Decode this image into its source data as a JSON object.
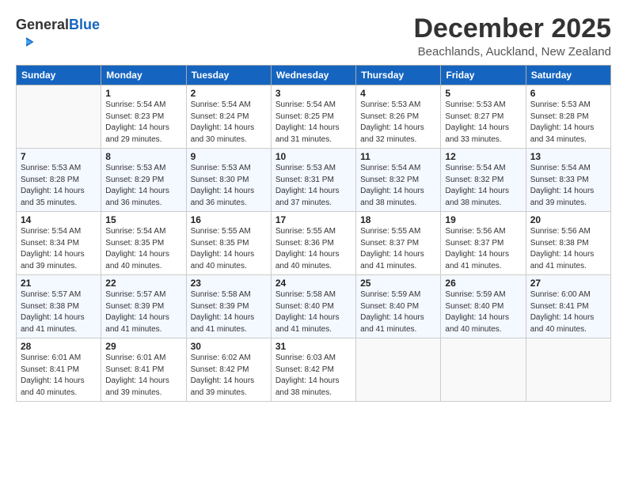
{
  "logo": {
    "general": "General",
    "blue": "Blue"
  },
  "title": "December 2025",
  "subtitle": "Beachlands, Auckland, New Zealand",
  "header_days": [
    "Sunday",
    "Monday",
    "Tuesday",
    "Wednesday",
    "Thursday",
    "Friday",
    "Saturday"
  ],
  "weeks": [
    [
      {
        "num": "",
        "info": ""
      },
      {
        "num": "1",
        "info": "Sunrise: 5:54 AM\nSunset: 8:23 PM\nDaylight: 14 hours\nand 29 minutes."
      },
      {
        "num": "2",
        "info": "Sunrise: 5:54 AM\nSunset: 8:24 PM\nDaylight: 14 hours\nand 30 minutes."
      },
      {
        "num": "3",
        "info": "Sunrise: 5:54 AM\nSunset: 8:25 PM\nDaylight: 14 hours\nand 31 minutes."
      },
      {
        "num": "4",
        "info": "Sunrise: 5:53 AM\nSunset: 8:26 PM\nDaylight: 14 hours\nand 32 minutes."
      },
      {
        "num": "5",
        "info": "Sunrise: 5:53 AM\nSunset: 8:27 PM\nDaylight: 14 hours\nand 33 minutes."
      },
      {
        "num": "6",
        "info": "Sunrise: 5:53 AM\nSunset: 8:28 PM\nDaylight: 14 hours\nand 34 minutes."
      }
    ],
    [
      {
        "num": "7",
        "info": "Sunrise: 5:53 AM\nSunset: 8:28 PM\nDaylight: 14 hours\nand 35 minutes."
      },
      {
        "num": "8",
        "info": "Sunrise: 5:53 AM\nSunset: 8:29 PM\nDaylight: 14 hours\nand 36 minutes."
      },
      {
        "num": "9",
        "info": "Sunrise: 5:53 AM\nSunset: 8:30 PM\nDaylight: 14 hours\nand 36 minutes."
      },
      {
        "num": "10",
        "info": "Sunrise: 5:53 AM\nSunset: 8:31 PM\nDaylight: 14 hours\nand 37 minutes."
      },
      {
        "num": "11",
        "info": "Sunrise: 5:54 AM\nSunset: 8:32 PM\nDaylight: 14 hours\nand 38 minutes."
      },
      {
        "num": "12",
        "info": "Sunrise: 5:54 AM\nSunset: 8:32 PM\nDaylight: 14 hours\nand 38 minutes."
      },
      {
        "num": "13",
        "info": "Sunrise: 5:54 AM\nSunset: 8:33 PM\nDaylight: 14 hours\nand 39 minutes."
      }
    ],
    [
      {
        "num": "14",
        "info": "Sunrise: 5:54 AM\nSunset: 8:34 PM\nDaylight: 14 hours\nand 39 minutes."
      },
      {
        "num": "15",
        "info": "Sunrise: 5:54 AM\nSunset: 8:35 PM\nDaylight: 14 hours\nand 40 minutes."
      },
      {
        "num": "16",
        "info": "Sunrise: 5:55 AM\nSunset: 8:35 PM\nDaylight: 14 hours\nand 40 minutes."
      },
      {
        "num": "17",
        "info": "Sunrise: 5:55 AM\nSunset: 8:36 PM\nDaylight: 14 hours\nand 40 minutes."
      },
      {
        "num": "18",
        "info": "Sunrise: 5:55 AM\nSunset: 8:37 PM\nDaylight: 14 hours\nand 41 minutes."
      },
      {
        "num": "19",
        "info": "Sunrise: 5:56 AM\nSunset: 8:37 PM\nDaylight: 14 hours\nand 41 minutes."
      },
      {
        "num": "20",
        "info": "Sunrise: 5:56 AM\nSunset: 8:38 PM\nDaylight: 14 hours\nand 41 minutes."
      }
    ],
    [
      {
        "num": "21",
        "info": "Sunrise: 5:57 AM\nSunset: 8:38 PM\nDaylight: 14 hours\nand 41 minutes."
      },
      {
        "num": "22",
        "info": "Sunrise: 5:57 AM\nSunset: 8:39 PM\nDaylight: 14 hours\nand 41 minutes."
      },
      {
        "num": "23",
        "info": "Sunrise: 5:58 AM\nSunset: 8:39 PM\nDaylight: 14 hours\nand 41 minutes."
      },
      {
        "num": "24",
        "info": "Sunrise: 5:58 AM\nSunset: 8:40 PM\nDaylight: 14 hours\nand 41 minutes."
      },
      {
        "num": "25",
        "info": "Sunrise: 5:59 AM\nSunset: 8:40 PM\nDaylight: 14 hours\nand 41 minutes."
      },
      {
        "num": "26",
        "info": "Sunrise: 5:59 AM\nSunset: 8:40 PM\nDaylight: 14 hours\nand 40 minutes."
      },
      {
        "num": "27",
        "info": "Sunrise: 6:00 AM\nSunset: 8:41 PM\nDaylight: 14 hours\nand 40 minutes."
      }
    ],
    [
      {
        "num": "28",
        "info": "Sunrise: 6:01 AM\nSunset: 8:41 PM\nDaylight: 14 hours\nand 40 minutes."
      },
      {
        "num": "29",
        "info": "Sunrise: 6:01 AM\nSunset: 8:41 PM\nDaylight: 14 hours\nand 39 minutes."
      },
      {
        "num": "30",
        "info": "Sunrise: 6:02 AM\nSunset: 8:42 PM\nDaylight: 14 hours\nand 39 minutes."
      },
      {
        "num": "31",
        "info": "Sunrise: 6:03 AM\nSunset: 8:42 PM\nDaylight: 14 hours\nand 38 minutes."
      },
      {
        "num": "",
        "info": ""
      },
      {
        "num": "",
        "info": ""
      },
      {
        "num": "",
        "info": ""
      }
    ]
  ]
}
